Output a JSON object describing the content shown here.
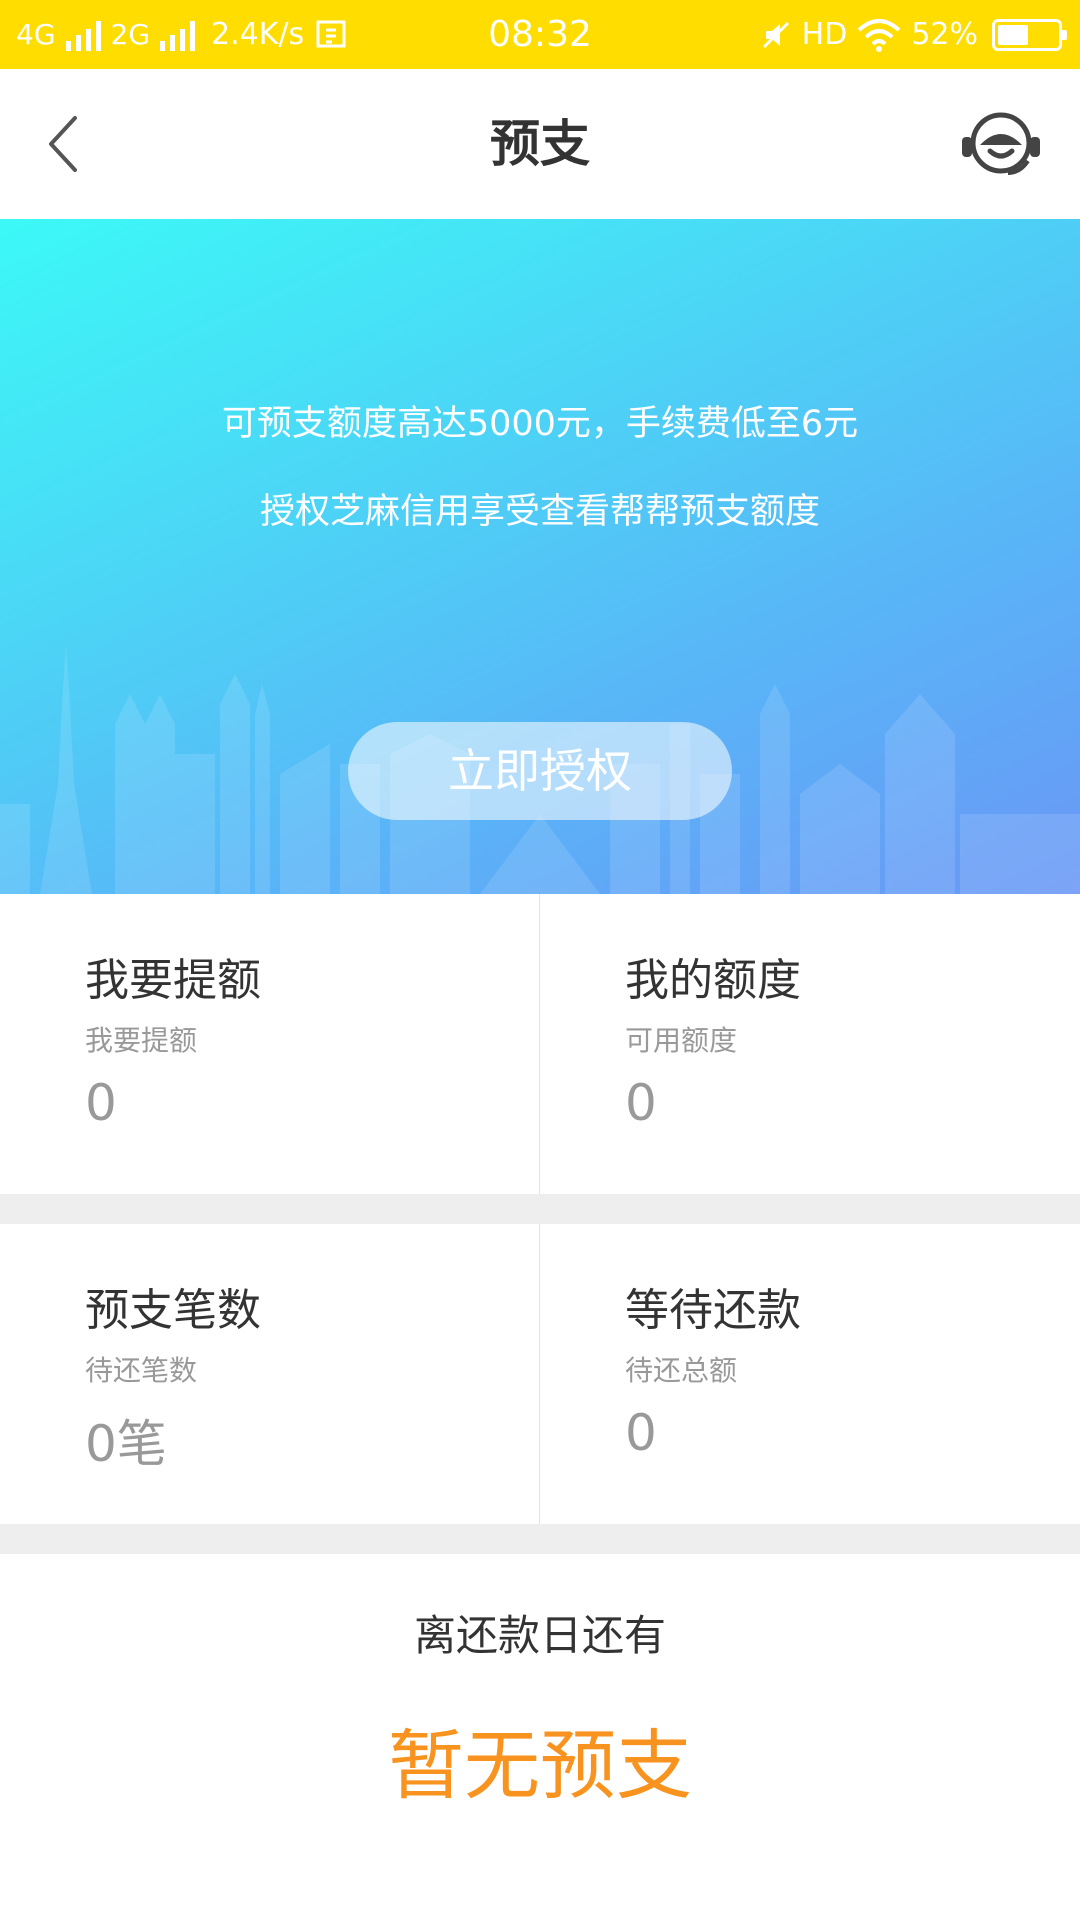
{
  "status_bar": {
    "net1": "4G",
    "net2": "2G",
    "speed": "2.4K/s",
    "time": "08:32",
    "hd": "HD",
    "battery": "52%",
    "battery_level": 0.52,
    "bg_color": "#FFDD00"
  },
  "header": {
    "title": "预支",
    "back_icon": "chevron-left-icon",
    "service_icon": "customer-service-icon"
  },
  "banner": {
    "line1": "可预支额度高达5000元，手续费低至6元",
    "line2": "授权芝麻信用享受查看帮帮预支额度",
    "button_label": "立即授权",
    "gradient_start": "#3CF9F7",
    "gradient_end": "#6A97F6"
  },
  "cards": [
    {
      "title": "我要提额",
      "subtitle": "我要提额",
      "value": "0"
    },
    {
      "title": "我的额度",
      "subtitle": "可用额度",
      "value": "0"
    },
    {
      "title": "预支笔数",
      "subtitle": "待还笔数",
      "value": "0笔"
    },
    {
      "title": "等待还款",
      "subtitle": "待还总额",
      "value": "0"
    }
  ],
  "countdown": {
    "label": "离还款日还有",
    "value": "暂无预支",
    "value_color": "#F7931E"
  }
}
